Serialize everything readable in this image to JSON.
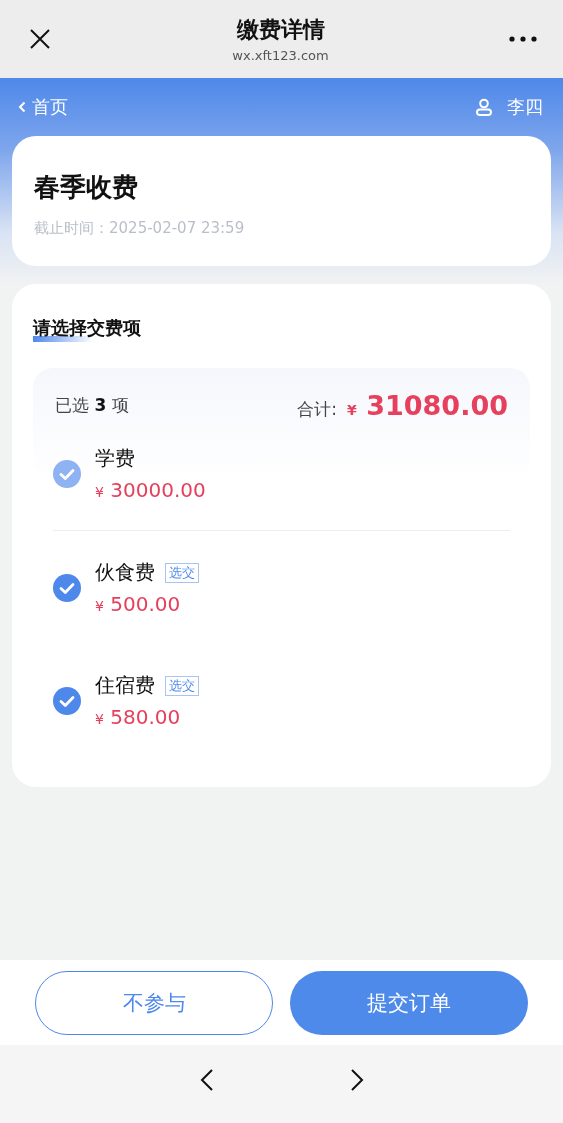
{
  "window": {
    "title": "缴费详情",
    "subtitle": "wx.xft123.com"
  },
  "nav": {
    "back_label": "首页",
    "user_name": "李四"
  },
  "bill": {
    "title": "春季收费",
    "deadline": "截止时间：2025-02-07 23:59"
  },
  "selection": {
    "heading": "请选择交费项",
    "count_prefix": "已选",
    "count": "3",
    "count_suffix": "项",
    "total_label": "合计:",
    "currency": "¥",
    "total": "31080.00",
    "items": [
      {
        "name": "学费",
        "currency": "¥",
        "amount": "30000.00",
        "checked": true,
        "disabled": true
      },
      {
        "name": "伙食费",
        "tag": "选交",
        "currency": "¥",
        "amount": "500.00",
        "checked": true,
        "disabled": false
      },
      {
        "name": "住宿费",
        "tag": "选交",
        "currency": "¥",
        "amount": "580.00",
        "checked": true,
        "disabled": false
      }
    ]
  },
  "buttons": [
    {
      "label": "不参与",
      "kind": "secondary"
    },
    {
      "label": "提交订单",
      "kind": "primary"
    }
  ]
}
